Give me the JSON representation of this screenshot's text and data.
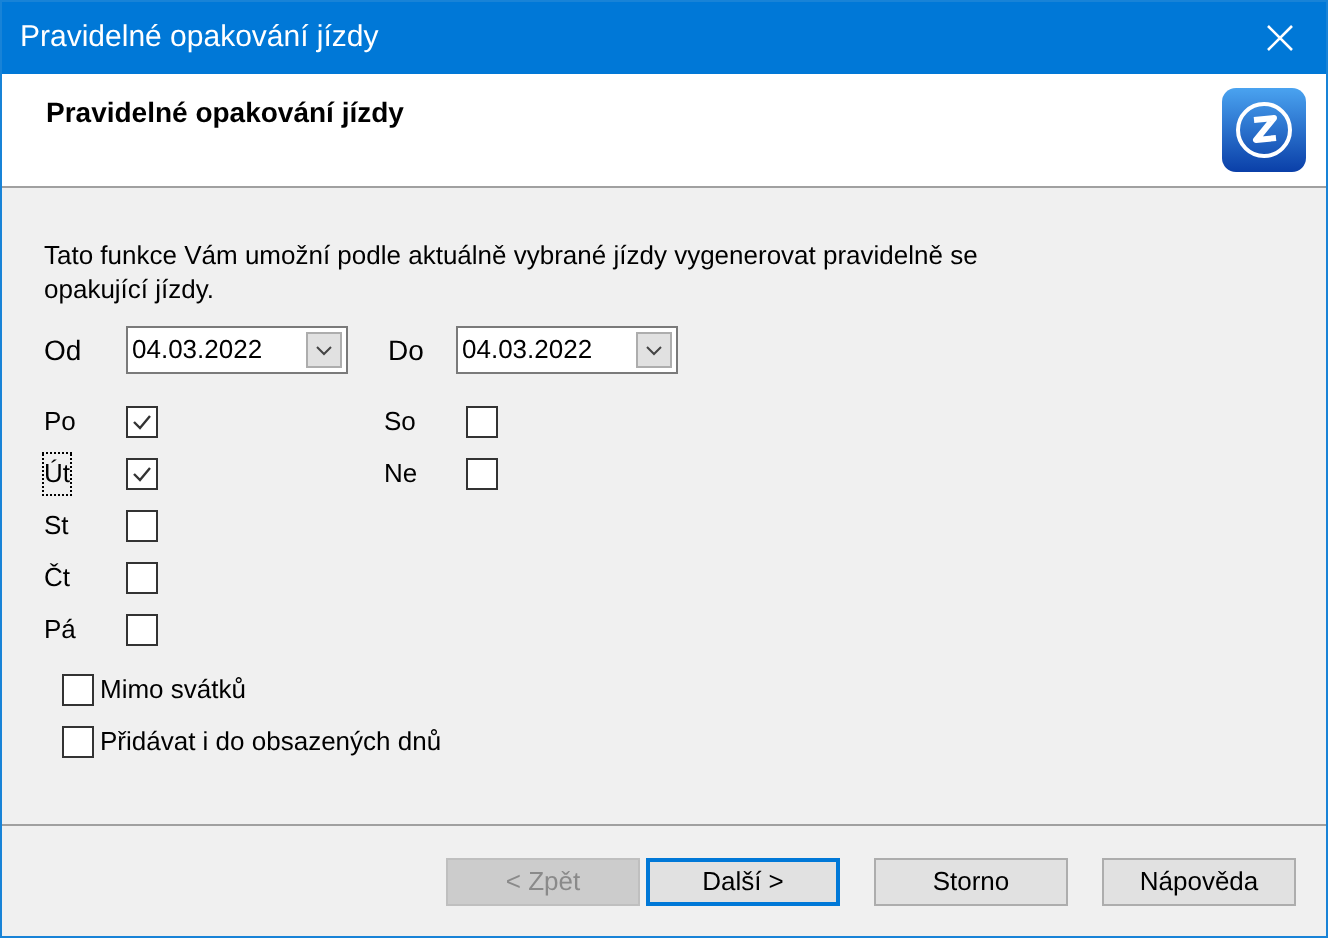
{
  "window": {
    "title": "Pravidelné opakování jízdy"
  },
  "header": {
    "title": "Pravidelné opakování jízdy"
  },
  "description": "Tato funkce Vám umožní podle aktuálně vybrané jízdy vygenerovat pravidelně se opakující jízdy.",
  "date_from": {
    "label": "Od",
    "value": "04.03.2022"
  },
  "date_to": {
    "label": "Do",
    "value": "04.03.2022"
  },
  "days_left": [
    {
      "label": "Po",
      "checked": true,
      "focused": false
    },
    {
      "label": "Út",
      "checked": true,
      "focused": true
    },
    {
      "label": "St",
      "checked": false,
      "focused": false
    },
    {
      "label": "Čt",
      "checked": false,
      "focused": false
    },
    {
      "label": "Pá",
      "checked": false,
      "focused": false
    }
  ],
  "days_right": [
    {
      "label": "So",
      "checked": false,
      "focused": false
    },
    {
      "label": "Ne",
      "checked": false,
      "focused": false
    }
  ],
  "options": [
    {
      "label": "Mimo svátků",
      "checked": false
    },
    {
      "label": "Přidávat i do obsazených dnů",
      "checked": false
    }
  ],
  "buttons": [
    {
      "label": "< Zpět",
      "disabled": true,
      "default": false
    },
    {
      "label": "Další >",
      "disabled": false,
      "default": true
    },
    {
      "label": "Storno",
      "disabled": false,
      "default": false
    },
    {
      "label": "Nápověda",
      "disabled": false,
      "default": false
    }
  ]
}
